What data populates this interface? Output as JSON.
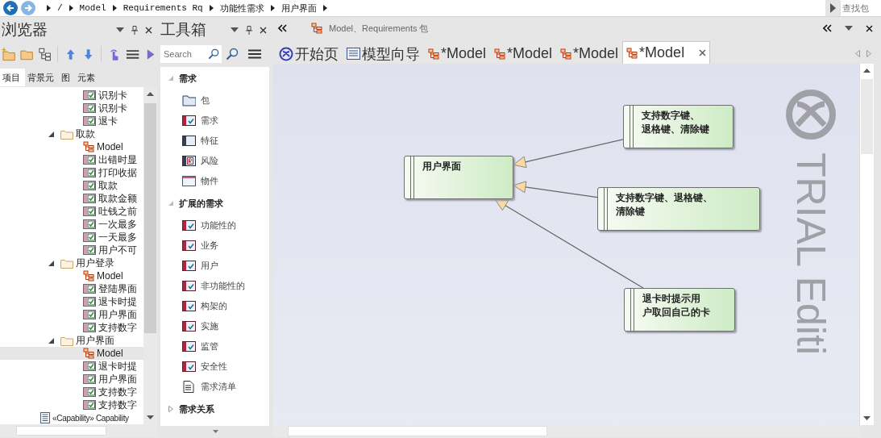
{
  "toolbar": {
    "breadcrumbs": [
      "/",
      "Model",
      "Requirements Rq",
      "功能性需求",
      "用户界面"
    ],
    "search": {
      "placeholder": "查找包"
    }
  },
  "browser": {
    "title": "浏览器",
    "tabs": [
      {
        "label": "项目",
        "selected": true
      },
      {
        "label": "背景元",
        "selected": false
      },
      {
        "label": "图",
        "selected": false
      },
      {
        "label": "元素",
        "selected": false
      }
    ],
    "tree": {
      "scrolled_children": [
        {
          "kind": "requirement",
          "label": "识别卡",
          "selected": false
        },
        {
          "kind": "requirement",
          "label": "识别卡",
          "selected": false
        },
        {
          "kind": "requirement",
          "label": "退卡",
          "selected": false
        }
      ],
      "items": [
        {
          "kind": "folder",
          "label": "取款",
          "expanded": true,
          "selected": false,
          "children": [
            {
              "kind": "diagram",
              "label": "Model",
              "selected": false
            },
            {
              "kind": "requirement",
              "label": "出错时显",
              "selected": false
            },
            {
              "kind": "requirement",
              "label": "打印收据",
              "selected": false
            },
            {
              "kind": "requirement",
              "label": "取款",
              "selected": false
            },
            {
              "kind": "requirement",
              "label": "取款金额",
              "selected": false
            },
            {
              "kind": "requirement",
              "label": "吐钱之前",
              "selected": false
            },
            {
              "kind": "requirement",
              "label": "一次最多",
              "selected": false
            },
            {
              "kind": "requirement",
              "label": "一天最多",
              "selected": false
            },
            {
              "kind": "requirement",
              "label": "用户不可",
              "selected": false
            }
          ]
        },
        {
          "kind": "folder",
          "label": "用户登录",
          "expanded": true,
          "selected": false,
          "children": [
            {
              "kind": "diagram",
              "label": "Model",
              "selected": false
            },
            {
              "kind": "requirement",
              "label": "登陆界面",
              "selected": false
            },
            {
              "kind": "requirement",
              "label": "退卡时提",
              "selected": false
            },
            {
              "kind": "requirement",
              "label": "用户界面",
              "selected": false
            },
            {
              "kind": "requirement",
              "label": "支持数字",
              "selected": false
            }
          ]
        },
        {
          "kind": "folder",
          "label": "用户界面",
          "expanded": true,
          "selected": false,
          "children": [
            {
              "kind": "diagram",
              "label": "Model",
              "selected": true
            },
            {
              "kind": "requirement",
              "label": "退卡时提",
              "selected": false
            },
            {
              "kind": "requirement",
              "label": "用户界面",
              "selected": false
            },
            {
              "kind": "requirement",
              "label": "支持数字",
              "selected": false
            },
            {
              "kind": "requirement",
              "label": "支持数字",
              "selected": false
            }
          ]
        },
        {
          "kind": "capability",
          "label": "«Capability» Capability",
          "selected": false
        }
      ]
    }
  },
  "toolbox": {
    "title": "工具箱",
    "search": {
      "placeholder": "Search"
    },
    "sections": [
      {
        "label": "需求",
        "expanded": true,
        "items": [
          {
            "kind": "package",
            "label": "包"
          },
          {
            "kind": "requirement",
            "label": "需求"
          },
          {
            "kind": "feature",
            "label": "特征"
          },
          {
            "kind": "risk",
            "label": "风险"
          },
          {
            "kind": "artifact",
            "label": "物件"
          }
        ]
      },
      {
        "label": "扩展的需求",
        "expanded": true,
        "items": [
          {
            "kind": "requirement",
            "label": "功能性的"
          },
          {
            "kind": "requirement",
            "label": "业务"
          },
          {
            "kind": "requirement",
            "label": "用户"
          },
          {
            "kind": "requirement",
            "label": "非功能性的"
          },
          {
            "kind": "requirement",
            "label": "构架的"
          },
          {
            "kind": "requirement",
            "label": "实施"
          },
          {
            "kind": "requirement",
            "label": "监管"
          },
          {
            "kind": "requirement",
            "label": "安全性"
          },
          {
            "kind": "list",
            "label": "需求清单"
          }
        ]
      },
      {
        "label": "需求关系",
        "expanded": false
      }
    ]
  },
  "diagram": {
    "header": "Model、Requirements 包",
    "tabs": [
      {
        "kind": "start",
        "label": "开始页",
        "selected": false
      },
      {
        "kind": "wizard",
        "label": "模型向导",
        "selected": false
      },
      {
        "kind": "diagram",
        "label": "*Model",
        "selected": false
      },
      {
        "kind": "diagram",
        "label": "*Model",
        "selected": false
      },
      {
        "kind": "diagram",
        "label": "*Model",
        "selected": false
      },
      {
        "kind": "diagram",
        "label": "*Model",
        "selected": true
      }
    ],
    "nodes": [
      {
        "lines": [
          "用户界面"
        ]
      },
      {
        "lines": [
          "支持数字键、",
          "退格键、清除键"
        ]
      },
      {
        "lines": [
          "支持数字键、退格键、",
          "清除键"
        ]
      },
      {
        "lines": [
          "退卡时提示用",
          "户取回自己的卡"
        ]
      }
    ],
    "watermark": "TRIAL Editi"
  }
}
